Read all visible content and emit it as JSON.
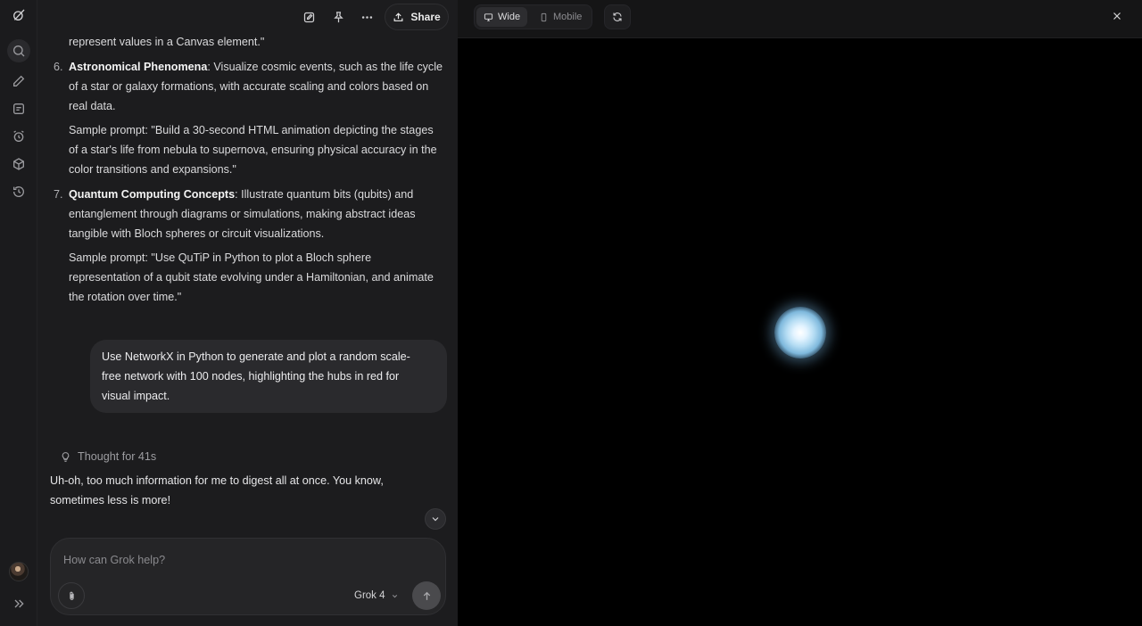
{
  "sidebar": {
    "logo": "grok-logo-icon",
    "icons": [
      "search-icon",
      "edit-icon",
      "notes-icon",
      "alarm-icon",
      "cube-icon",
      "history-icon"
    ],
    "expand_icon": "chevron-double-right-icon"
  },
  "chat_header": {
    "share_label": "Share"
  },
  "chat": {
    "intro_tail": "represent values in a Canvas element.\"",
    "items": [
      {
        "number": "6.",
        "title": "Astronomical Phenomena",
        "description_line1": ": Visualize cosmic events, such as the life cycle",
        "description_line2": "of a star or galaxy formations, with accurate scaling and colors based on",
        "description_line3": "real data.",
        "sample_line1": "Sample prompt: \"Build a 30-second HTML animation depicting the stages",
        "sample_line2": "of a star's life from nebula to supernova, ensuring physical accuracy in the",
        "sample_line3": "color transitions and expansions.\""
      },
      {
        "number": "7.",
        "title": "Quantum Computing Concepts",
        "description_line1": ": Illustrate quantum bits (qubits) and",
        "description_line2": "entanglement through diagrams or simulations, making abstract ideas",
        "description_line3": "tangible with Bloch spheres or circuit visualizations.",
        "sample_line1": "Sample prompt: \"Use QuTiP in Python to plot a Bloch sphere",
        "sample_line2": "representation of a qubit state evolving under a Hamiltonian, and animate",
        "sample_line3": "the rotation over time.\""
      }
    ],
    "user_message_line1": "Use NetworkX in Python to generate and plot a random scale-",
    "user_message_line2": "free network with 100 nodes, highlighting the hubs in red for",
    "user_message_line3": "visual impact.",
    "thought_label": "Thought for 41s",
    "reply_line1": "Uh-oh, too much information for me to digest all at once. You know,",
    "reply_line2": "sometimes less is more!"
  },
  "composer": {
    "placeholder": "How can Grok help?",
    "model": "Grok 4"
  },
  "preview": {
    "view_wide": "Wide",
    "view_mobile": "Mobile",
    "active_view": "Wide"
  }
}
